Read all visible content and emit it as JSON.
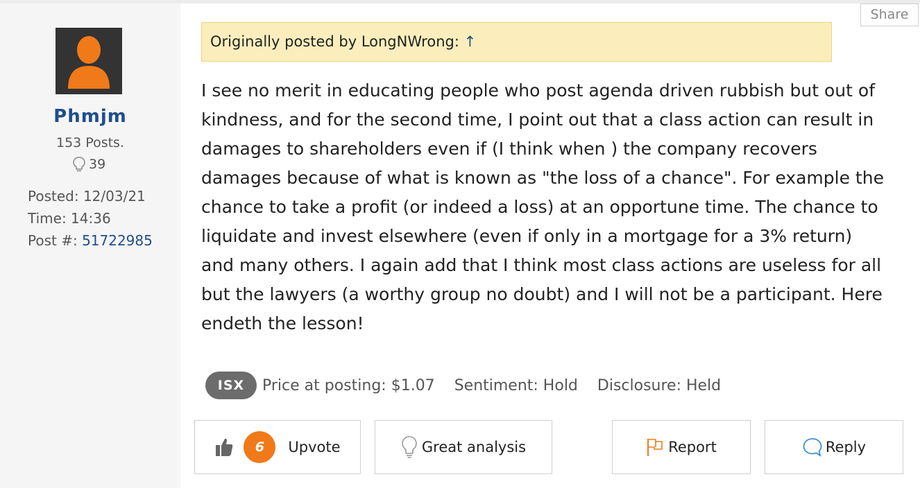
{
  "share_label": "Share",
  "user": {
    "name": "Phmjm",
    "posts": "153 Posts.",
    "likes": "39",
    "posted_label": "Posted:",
    "posted_value": "12/03/21",
    "time_label": "Time:",
    "time_value": "14:36",
    "postnum_label": "Post #:",
    "postnum_value": "51722985"
  },
  "quote": {
    "text": "Originally posted by LongNWrong:",
    "arrow": "↑"
  },
  "post_body": "I see no merit in educating people who post agenda driven rubbish but out of kindness, and for the second time, I point out that a class action can result in damages to shareholders even if (I think when ) the company recovers damages because of what is known as \"the loss of a chance\". For example the chance to take a profit (or indeed a loss) at an opportune time. The chance to liquidate and invest elsewhere (even if only in a mortgage for a 3% return) and many others. I again add that I think most class actions are useless for all but the lawyers (a worthy group no doubt) and I will not be a participant. Here endeth the lesson!",
  "tags": {
    "ticker": "ISX",
    "price": "Price at posting: $1.07",
    "sentiment": "Sentiment: Hold",
    "disclosure": "Disclosure: Held"
  },
  "actions": {
    "upvote_count": "6",
    "upvote_label": "Upvote",
    "great_label": "Great analysis",
    "report_label": "Report",
    "reply_label": "Reply"
  },
  "colors": {
    "accent_orange": "#f07a1a",
    "link_blue": "#1f4e8c",
    "quote_bg": "#fbeebc",
    "sidebar_bg": "#f5f5f5"
  }
}
